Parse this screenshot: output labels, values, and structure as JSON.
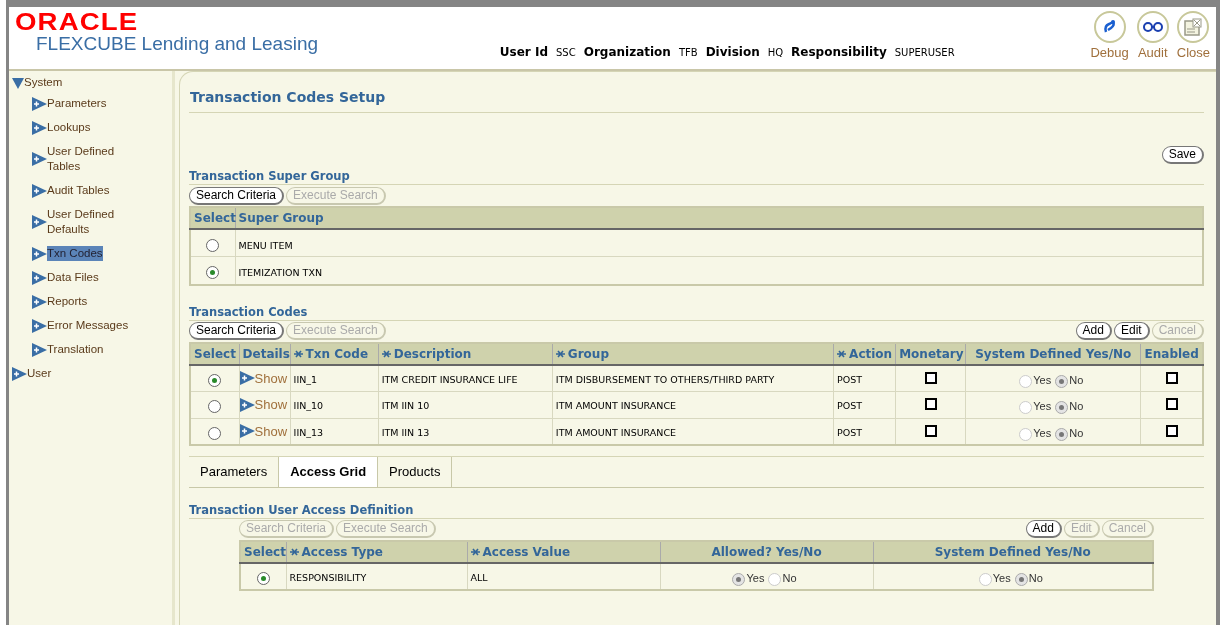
{
  "header": {
    "brand": "ORACLE",
    "product": "FLEXCUBE Lending and Leasing",
    "user_info": [
      {
        "label": "User Id",
        "value": "SSC"
      },
      {
        "label": "Organization",
        "value": "TFB"
      },
      {
        "label": "Division",
        "value": "HQ"
      },
      {
        "label": "Responsibility",
        "value": "SUPERUSER"
      }
    ],
    "actions": [
      {
        "kind": "debug",
        "label": "Debug"
      },
      {
        "kind": "audit",
        "label": "Audit"
      },
      {
        "kind": "close",
        "label": "Close"
      }
    ]
  },
  "sidebar": {
    "items": [
      {
        "label": "System",
        "expanded": true,
        "selected": false,
        "children": [
          {
            "label": "Parameters",
            "expanded": false,
            "selected": false
          },
          {
            "label": "Lookups",
            "expanded": false,
            "selected": false
          },
          {
            "label": "User Defined Tables",
            "expanded": false,
            "selected": false
          },
          {
            "label": "Audit Tables",
            "expanded": false,
            "selected": false
          },
          {
            "label": "User Defined Defaults",
            "expanded": false,
            "selected": false
          },
          {
            "label": "Txn Codes",
            "expanded": false,
            "selected": true
          },
          {
            "label": "Data Files",
            "expanded": false,
            "selected": false
          },
          {
            "label": "Reports",
            "expanded": false,
            "selected": false
          },
          {
            "label": "Error Messages",
            "expanded": false,
            "selected": false
          },
          {
            "label": "Translation",
            "expanded": false,
            "selected": false
          }
        ]
      },
      {
        "label": "User",
        "expanded": false,
        "selected": false
      }
    ]
  },
  "page": {
    "title": "Transaction Codes Setup",
    "save_button": "Save"
  },
  "super_group": {
    "title": "Transaction Super Group",
    "search_buttons": [
      {
        "label": "Search Criteria",
        "disabled": false
      },
      {
        "label": "Execute Search",
        "disabled": true
      }
    ],
    "columns": [
      {
        "label": "Select",
        "required": false
      },
      {
        "label": "Super Group",
        "required": false
      }
    ],
    "rows": [
      {
        "selected": false,
        "super_group": "MENU ITEM"
      },
      {
        "selected": true,
        "super_group": "ITEMIZATION TXN"
      }
    ]
  },
  "transaction_codes": {
    "title": "Transaction Codes",
    "search_buttons": [
      {
        "label": "Search Criteria",
        "disabled": false
      },
      {
        "label": "Execute Search",
        "disabled": true
      }
    ],
    "action_buttons": [
      {
        "label": "Add",
        "disabled": false
      },
      {
        "label": "Edit",
        "disabled": false
      },
      {
        "label": "Cancel",
        "disabled": true
      }
    ],
    "columns": [
      {
        "label": "Select",
        "required": false
      },
      {
        "label": "Details",
        "required": false
      },
      {
        "label": "Txn Code",
        "required": true
      },
      {
        "label": "Description",
        "required": true
      },
      {
        "label": "Group",
        "required": true
      },
      {
        "label": "Action",
        "required": true
      },
      {
        "label": "Monetary",
        "required": false
      },
      {
        "label": "System Defined Yes/No",
        "required": false
      },
      {
        "label": "Enabled",
        "required": false
      }
    ],
    "rows": [
      {
        "selected": true,
        "details": "Show",
        "txn_code": "IIN_1",
        "description": "ITM CREDIT INSURANCE LIFE",
        "group": "ITM DISBURSEMENT TO OTHERS/THIRD PARTY",
        "action": "POST",
        "monetary": false,
        "system_defined": [
          {
            "label": "Yes",
            "selected": false
          },
          {
            "label": "No",
            "selected": true
          }
        ],
        "enabled": false
      },
      {
        "selected": false,
        "details": "Show",
        "txn_code": "IIN_10",
        "description": "ITM IIN 10",
        "group": "ITM AMOUNT INSURANCE",
        "action": "POST",
        "monetary": false,
        "system_defined": [
          {
            "label": "Yes",
            "selected": false
          },
          {
            "label": "No",
            "selected": true
          }
        ],
        "enabled": false
      },
      {
        "selected": false,
        "details": "Show",
        "txn_code": "IIN_13",
        "description": "ITM IIN 13",
        "group": "ITM AMOUNT INSURANCE",
        "action": "POST",
        "monetary": false,
        "system_defined": [
          {
            "label": "Yes",
            "selected": false
          },
          {
            "label": "No",
            "selected": true
          }
        ],
        "enabled": false
      }
    ]
  },
  "tabs": [
    {
      "label": "Parameters",
      "selected": false
    },
    {
      "label": "Access Grid",
      "selected": true
    },
    {
      "label": "Products",
      "selected": false
    }
  ],
  "access": {
    "title": "Transaction User Access Definition",
    "search_buttons": [
      {
        "label": "Search Criteria",
        "disabled": true
      },
      {
        "label": "Execute Search",
        "disabled": true
      }
    ],
    "action_buttons": [
      {
        "label": "Add",
        "disabled": false
      },
      {
        "label": "Edit",
        "disabled": true
      },
      {
        "label": "Cancel",
        "disabled": true
      }
    ],
    "columns": [
      {
        "label": "Select",
        "required": false
      },
      {
        "label": "Access Type",
        "required": true
      },
      {
        "label": "Access Value",
        "required": true
      },
      {
        "label": "Allowed? Yes/No",
        "required": false
      },
      {
        "label": "System Defined Yes/No",
        "required": false
      }
    ],
    "rows": [
      {
        "selected": true,
        "access_type": "RESPONSIBILITY",
        "access_value": "ALL",
        "allowed": [
          {
            "label": "Yes",
            "selected": true
          },
          {
            "label": "No",
            "selected": false
          }
        ],
        "system_defined": [
          {
            "label": "Yes",
            "selected": false
          },
          {
            "label": "No",
            "selected": true
          }
        ]
      }
    ]
  }
}
